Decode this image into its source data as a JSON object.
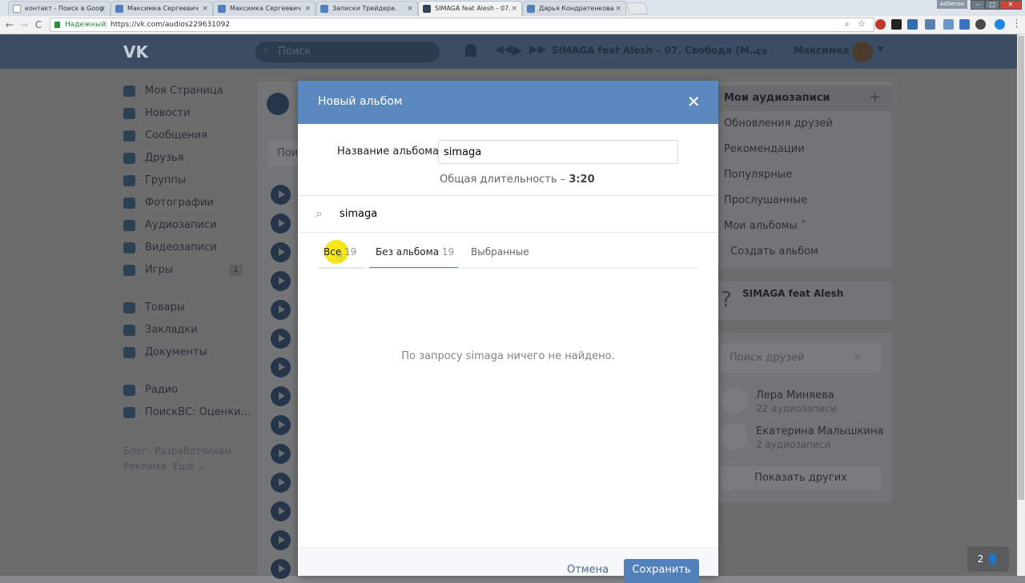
{
  "browser": {
    "tabs": [
      {
        "title": "контакт - Поиск в Goog",
        "active": false
      },
      {
        "title": "Максимка Сергеевич",
        "active": false
      },
      {
        "title": "Максимка Сергеевич",
        "active": false
      },
      {
        "title": "Записки Трейдера.",
        "active": false
      },
      {
        "title": "SIMAGA feat Alesh - 07.",
        "active": true
      },
      {
        "title": "Дарья Кондратенкова",
        "active": false
      }
    ],
    "tab_close": "×",
    "window_badge": "AdSense",
    "secure_label": "Надежный",
    "url": "https://vk.com/audios229631092",
    "back_icon": "←",
    "forward_icon": "→",
    "reload_icon": "C"
  },
  "vk_header": {
    "logo": "VK",
    "search_placeholder": "Поиск",
    "now_playing": "SIMAGA feat Alesh – 07. Свобода (М...",
    "user_name": "Максимка",
    "repeat_label": "cs"
  },
  "sidebar": {
    "items": [
      {
        "label": "Моя Страница",
        "icon": "home-icon"
      },
      {
        "label": "Новости",
        "icon": "news-icon"
      },
      {
        "label": "Сообщения",
        "icon": "messages-icon"
      },
      {
        "label": "Друзья",
        "icon": "friends-icon"
      },
      {
        "label": "Группы",
        "icon": "groups-icon"
      },
      {
        "label": "Фотографии",
        "icon": "photos-icon"
      },
      {
        "label": "Аудиозаписи",
        "icon": "music-icon"
      },
      {
        "label": "Видеозаписи",
        "icon": "video-icon"
      },
      {
        "label": "Игры",
        "icon": "games-icon",
        "badge": "1"
      },
      {
        "label": "Товары",
        "icon": "market-icon"
      },
      {
        "label": "Закладки",
        "icon": "star-icon"
      },
      {
        "label": "Документы",
        "icon": "docs-icon"
      },
      {
        "label": "Радио",
        "icon": "app-icon"
      },
      {
        "label": "ПоискВС: Оценки...",
        "icon": "app-icon"
      }
    ],
    "footer": {
      "blog": "Блог",
      "dev": "Разработчикам",
      "ads": "Реклама",
      "more": "Ещё ⌄"
    }
  },
  "main": {
    "search_fragment": "Пои"
  },
  "right_menu": {
    "items": [
      "Мои аудиозаписи",
      "Обновления друзей",
      "Рекомендации",
      "Популярные",
      "Прослушанные",
      "Мои альбомы ˄",
      "Создать альбом"
    ],
    "add_icon": "+",
    "now_playing_card": "SIMAGA feat Alesh",
    "now_playing_icon": "?",
    "friend_search_placeholder": "Поиск друзей",
    "friends": [
      {
        "name": "Лера Миняева",
        "sub": "22 аудиозаписи"
      },
      {
        "name": "Екатерина Малышкина",
        "sub": "2 аудиозаписи"
      }
    ],
    "show_more": "Показать других"
  },
  "modal": {
    "title": "Новый альбом",
    "close": "✕",
    "name_label": "Название альбома",
    "name_value": "simaga",
    "duration_label": "Общая длительность –",
    "duration_value": "3:20",
    "search_value": "simaga",
    "tabs": [
      {
        "label": "Все",
        "count": "19"
      },
      {
        "label": "Без альбома",
        "count": "19"
      },
      {
        "label": "Выбранные",
        "count": ""
      }
    ],
    "empty_text": "По запросу simaga ничего не найдено.",
    "cancel": "Отмена",
    "save": "Сохранить"
  },
  "chat_widget": {
    "count": "2"
  },
  "colors": {
    "vk_blue": "#5181b8",
    "modal_header": "#5b88bd",
    "overlay_page": "#6c6c6d"
  }
}
